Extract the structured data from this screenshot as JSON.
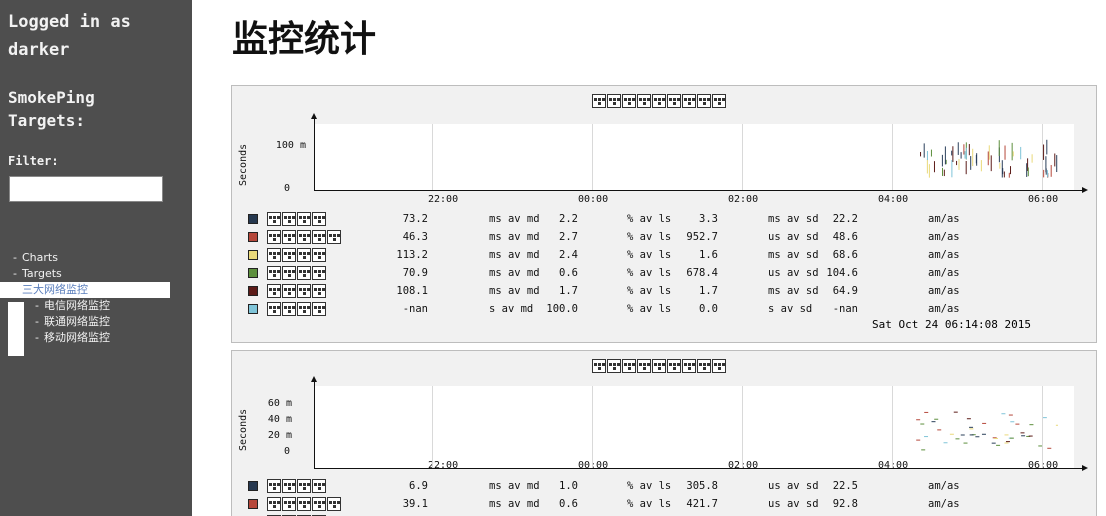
{
  "sidebar": {
    "login_line1": "Logged in as",
    "login_line2": "darker",
    "title_line1": "SmokePing",
    "title_line2": "Targets:",
    "filter_label": "Filter:",
    "filter_value": "",
    "menu": [
      {
        "label": "Charts",
        "bullet": "-"
      },
      {
        "label": "Targets",
        "bullet": "-"
      },
      {
        "label": "三大网络监控",
        "bullet": "",
        "active": true
      },
      {
        "label": "电信网络监控",
        "bullet": "-"
      },
      {
        "label": "联通网络监控",
        "bullet": "-"
      },
      {
        "label": "移动网络监控",
        "bullet": "-"
      }
    ]
  },
  "page": {
    "title": "监控统计"
  },
  "graphs": [
    {
      "y_unit": "Seconds",
      "y_ticks": [
        "100 m",
        "0"
      ],
      "x_ticks": [
        "22:00",
        "00:00",
        "02:00",
        "04:00",
        "06:00"
      ],
      "legend_colors": [
        "#26384f",
        "#b5473a",
        "#ead97a",
        "#5d8f3d",
        "#5c1b18",
        "#7fc4d8"
      ],
      "rows": [
        {
          "median": "73.2",
          "mu": "ms",
          "loss": "2.2",
          "sd": "3.3",
          "su": "ms",
          "ams": "22.2"
        },
        {
          "median": "46.3",
          "mu": "ms",
          "loss": "2.7",
          "sd": "952.7",
          "su": "us",
          "ams": "48.6"
        },
        {
          "median": "113.2",
          "mu": "ms",
          "loss": "2.4",
          "sd": "1.6",
          "su": "ms",
          "ams": "68.6"
        },
        {
          "median": "70.9",
          "mu": "ms",
          "loss": "0.6",
          "sd": "678.4",
          "su": "us",
          "ams": "104.6"
        },
        {
          "median": "108.1",
          "mu": "ms",
          "loss": "1.7",
          "sd": "1.7",
          "su": "ms",
          "ams": "64.9"
        },
        {
          "median": "-nan",
          "mu": "s",
          "loss": "100.0",
          "sd": "0.0",
          "su": "s",
          "ams": "-nan"
        }
      ],
      "timestamp": "Sat Oct 24 06:14:08 2015"
    },
    {
      "y_unit": "Seconds",
      "y_ticks": [
        "60 m",
        "40 m",
        "20 m",
        "0"
      ],
      "x_ticks": [
        "22:00",
        "00:00",
        "02:00",
        "04:00",
        "06:00"
      ],
      "legend_colors": [
        "#26384f",
        "#b5473a",
        "#ead97a"
      ],
      "rows": [
        {
          "median": "6.9",
          "mu": "ms",
          "loss": "1.0",
          "sd": "305.8",
          "su": "us",
          "ams": "22.5"
        },
        {
          "median": "39.1",
          "mu": "ms",
          "loss": "0.6",
          "sd": "421.7",
          "su": "us",
          "ams": "92.8"
        }
      ]
    }
  ],
  "labels": {
    "av_md": "av md",
    "av_ls": "av ls",
    "av_sd": "av sd",
    "amas": "am/as",
    "pct": "%"
  }
}
